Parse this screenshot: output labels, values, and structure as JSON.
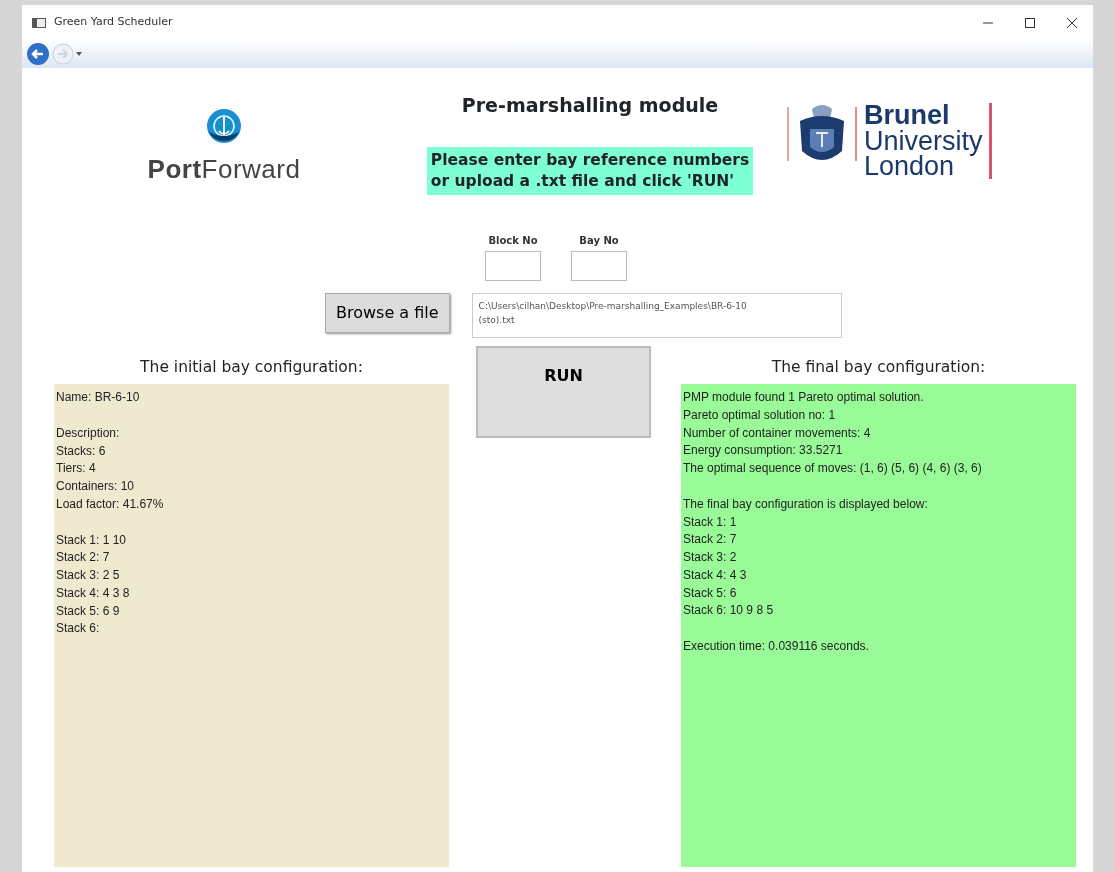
{
  "window": {
    "title": "Green Yard Scheduler"
  },
  "logos": {
    "left": {
      "bold": "Port",
      "light": "Forward"
    },
    "right": {
      "lines": [
        "Brunel",
        "University",
        "London"
      ]
    }
  },
  "heading": "Pre-marshalling module",
  "instruction": [
    "Please enter bay reference numbers",
    "or upload a .txt file and click 'RUN'"
  ],
  "fields": [
    {
      "label": "Block No"
    },
    {
      "label": "Bay No"
    }
  ],
  "browse_button": "Browse a file",
  "file_path": [
    "C:\\Users\\cilhan\\Desktop\\Pre-marshalling_Examples\\BR-6-10",
    "(sto).txt"
  ],
  "run_button": "RUN",
  "initial": {
    "title": "The initial bay configuration:",
    "paragraphs": [
      [
        "Name: BR-6-10"
      ],
      [
        "Description:",
        "Stacks: 6",
        "Tiers: 4",
        "Containers: 10",
        "Load factor: 41.67%"
      ],
      [
        "Stack 1: 1 10",
        "Stack 2: 7",
        "Stack 3: 2 5",
        "Stack 4: 4 3 8",
        "Stack 5: 6 9",
        "Stack 6:"
      ]
    ]
  },
  "final": {
    "title": "The final bay configuration:",
    "paragraphs": [
      [
        "PMP module found 1 Pareto optimal solution.",
        "Pareto optimal solution no: 1",
        "Number of container movements: 4",
        "Energy consumption: 33.5271",
        "The optimal sequence of moves: (1, 6) (5, 6) (4, 6) (3, 6)"
      ],
      [
        "The final bay configuration is displayed below:",
        "Stack 1: 1",
        "Stack 2: 7",
        "Stack 3: 2",
        "Stack 4: 4 3",
        "Stack 5: 6",
        "Stack 6: 10 9 8 5"
      ],
      [
        "Execution time: 0.039116 seconds."
      ]
    ]
  }
}
